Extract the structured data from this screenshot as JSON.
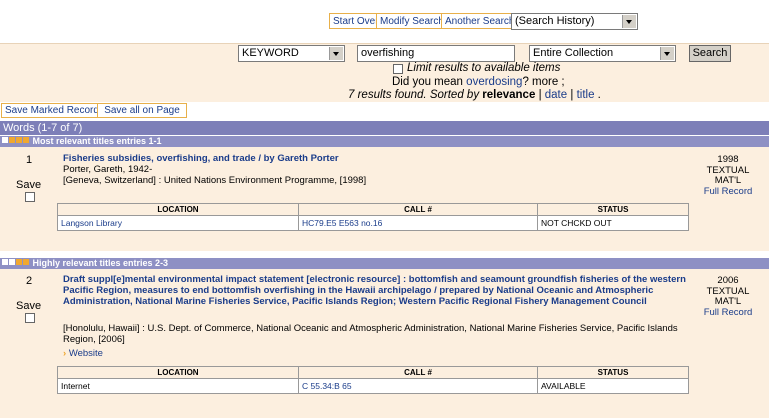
{
  "toolbar": {
    "start_over": "Start Over",
    "modify_search": "Modify Search",
    "another_search": "Another Search",
    "search_history": "(Search History)"
  },
  "search": {
    "field": "KEYWORD",
    "query": "overfishing",
    "scope": "Entire Collection",
    "button": "Search",
    "limit_label": "Limit results to available items",
    "did_you_mean_prefix": "Did you mean",
    "suggestion": "overdosing",
    "did_you_mean_suffix": "? more ;",
    "results_text": "7 results found.",
    "sorted_by": "Sorted by",
    "sort_relevance": "relevance",
    "sort_date": "date",
    "sort_title": "title",
    "sep": "|",
    "end": "."
  },
  "actions": {
    "save_marked": "Save Marked Records",
    "save_all": "Save all on Page"
  },
  "results_header": "Words (1-7 of 7)",
  "colors": {
    "bar": "#7d7fb8",
    "band": "#fcefdf",
    "link": "#1a3c8a"
  },
  "groups": [
    {
      "label": "Most relevant titles entries 1-1",
      "entries": [
        {
          "number": "1",
          "save_label": "Save",
          "title": "Fisheries subsidies, overfishing, and trade / by Gareth Porter",
          "author": "Porter, Gareth, 1942-",
          "publication": "[Geneva, Switzerland] : United Nations Environment Programme, [1998]",
          "year": "1998",
          "type": "TEXTUAL MAT'L",
          "full_record": "Full Record",
          "holdings_headers": [
            "LOCATION",
            "CALL #",
            "STATUS"
          ],
          "holdings": [
            [
              "Langson Library",
              "HC79.E5 E563 no.16",
              "NOT CHCKD OUT"
            ]
          ]
        }
      ]
    },
    {
      "label": "Highly relevant titles entries 2-3",
      "entries": [
        {
          "number": "2",
          "save_label": "Save",
          "title": "Draft suppl[e]mental environmental impact statement [electronic resource] : bottomfish and seamount groundfish fisheries of the western Pacific Region, measures to end bottomfish overfishing in the Hawaii archipelago / prepared by National Oceanic and Atmospheric Administration, National Marine Fisheries Service, Pacific Islands Region; Western Pacific Regional Fishery Management Council",
          "publication": "[Honolulu, Hawaii] : U.S. Dept. of Commerce, National Oceanic and Atmospheric Administration, National Marine Fisheries Service, Pacific Islands Region, [2006]",
          "website": "Website",
          "year": "2006",
          "type": "TEXTUAL MAT'L",
          "full_record": "Full Record",
          "holdings_headers": [
            "LOCATION",
            "CALL #",
            "STATUS"
          ],
          "holdings": [
            [
              "Internet",
              "C 55.34:B 65",
              "AVAILABLE"
            ]
          ]
        }
      ]
    }
  ]
}
